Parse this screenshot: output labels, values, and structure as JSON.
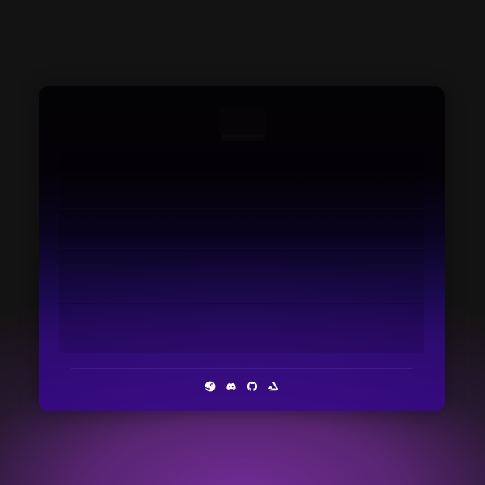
{
  "socials": [
    {
      "icon": "steam-icon"
    },
    {
      "icon": "discord-icon"
    },
    {
      "icon": "github-icon"
    },
    {
      "icon": "artstation-icon"
    }
  ],
  "colors": {
    "page_background": "#141314",
    "card_top": "#030204",
    "card_bottom": "#33087a",
    "bottom_glow": "#702c96",
    "icon": "#ffffff"
  }
}
